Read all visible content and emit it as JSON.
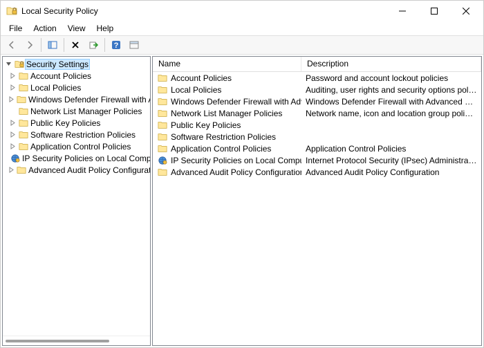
{
  "titlebar": {
    "title": "Local Security Policy"
  },
  "menubar": {
    "file": "File",
    "action": "Action",
    "view": "View",
    "help": "Help"
  },
  "tree": {
    "root_label": "Security Settings",
    "items": [
      {
        "label": "Account Policies",
        "icon": "folder"
      },
      {
        "label": "Local Policies",
        "icon": "folder"
      },
      {
        "label": "Windows Defender Firewall with Advanced Security",
        "icon": "folder"
      },
      {
        "label": "Network List Manager Policies",
        "icon": "folder",
        "expandable": false
      },
      {
        "label": "Public Key Policies",
        "icon": "folder"
      },
      {
        "label": "Software Restriction Policies",
        "icon": "folder"
      },
      {
        "label": "Application Control Policies",
        "icon": "folder"
      },
      {
        "label": "IP Security Policies on Local Computer",
        "icon": "ipsec",
        "expandable": false
      },
      {
        "label": "Advanced Audit Policy Configuration",
        "icon": "folder"
      }
    ]
  },
  "list": {
    "header_name": "Name",
    "header_desc": "Description",
    "rows": [
      {
        "name": "Account Policies",
        "desc": "Password and account lockout policies",
        "icon": "folder"
      },
      {
        "name": "Local Policies",
        "desc": "Auditing, user rights and security options policies",
        "icon": "folder"
      },
      {
        "name": "Windows Defender Firewall with Advanced Security",
        "desc": "Windows Defender Firewall with Advanced Security",
        "icon": "folder"
      },
      {
        "name": "Network List Manager Policies",
        "desc": "Network name, icon and location group policies.",
        "icon": "folder"
      },
      {
        "name": "Public Key Policies",
        "desc": "",
        "icon": "folder"
      },
      {
        "name": "Software Restriction Policies",
        "desc": "",
        "icon": "folder"
      },
      {
        "name": "Application Control Policies",
        "desc": "Application Control Policies",
        "icon": "folder"
      },
      {
        "name": "IP Security Policies on Local Computer",
        "desc": "Internet Protocol Security (IPsec) Administration. Manage IPsec policies.",
        "icon": "ipsec"
      },
      {
        "name": "Advanced Audit Policy Configuration",
        "desc": "Advanced Audit Policy Configuration",
        "icon": "folder"
      }
    ]
  }
}
